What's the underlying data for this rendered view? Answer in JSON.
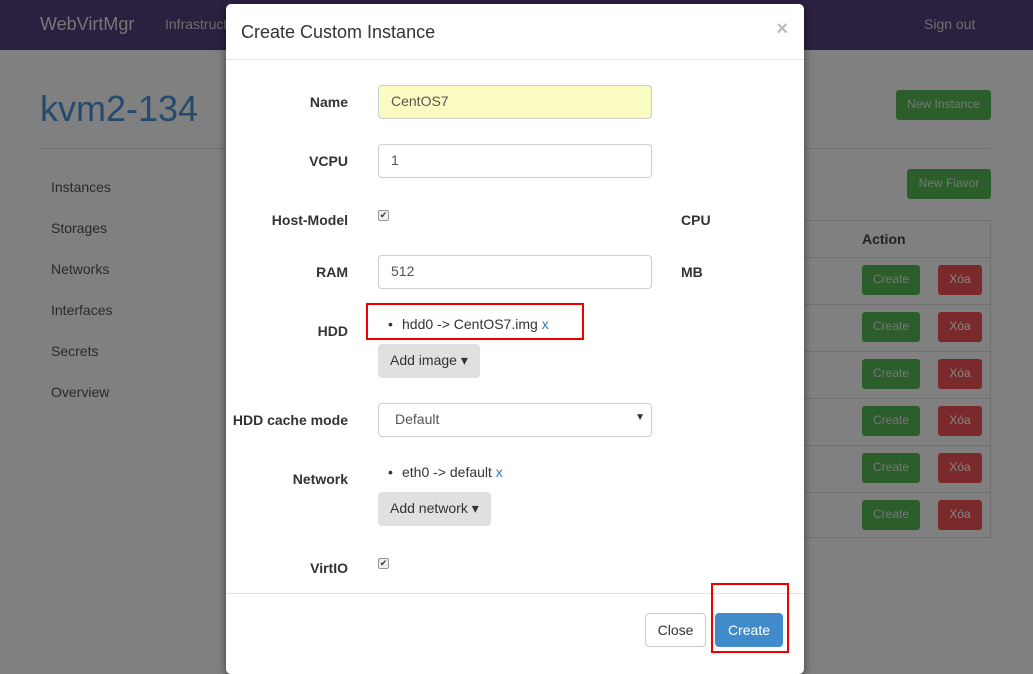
{
  "nav": {
    "brand": "WebVirtMgr",
    "link": "Infrastructure",
    "signout": "Sign out"
  },
  "page": {
    "title": "kvm2-134",
    "new_instance": "New Instance",
    "new_flavor": "New Flavor"
  },
  "sidebar": [
    "Instances",
    "Storages",
    "Networks",
    "Interfaces",
    "Secrets",
    "Overview"
  ],
  "table": {
    "action_header": "Action",
    "create": "Create",
    "delete": "Xóa"
  },
  "modal": {
    "title": "Create Custom Instance",
    "close_x": "×",
    "name_label": "Name",
    "name_value": "CentOS7",
    "vcpu_label": "VCPU",
    "vcpu_value": "1",
    "hostmodel_label": "Host-Model",
    "cpu_unit": "CPU",
    "ram_label": "RAM",
    "ram_value": "512",
    "ram_unit": "MB",
    "hdd_label": "HDD",
    "hdd_item": "hdd0 -> CentOS7.img",
    "remove": "x",
    "add_image": "Add image",
    "cache_label": "HDD cache mode",
    "cache_value": "Default",
    "network_label": "Network",
    "network_item": "eth0 -> default",
    "add_network": "Add network",
    "virtio_label": "VirtIO",
    "close_button": "Close",
    "create_button": "Create"
  }
}
